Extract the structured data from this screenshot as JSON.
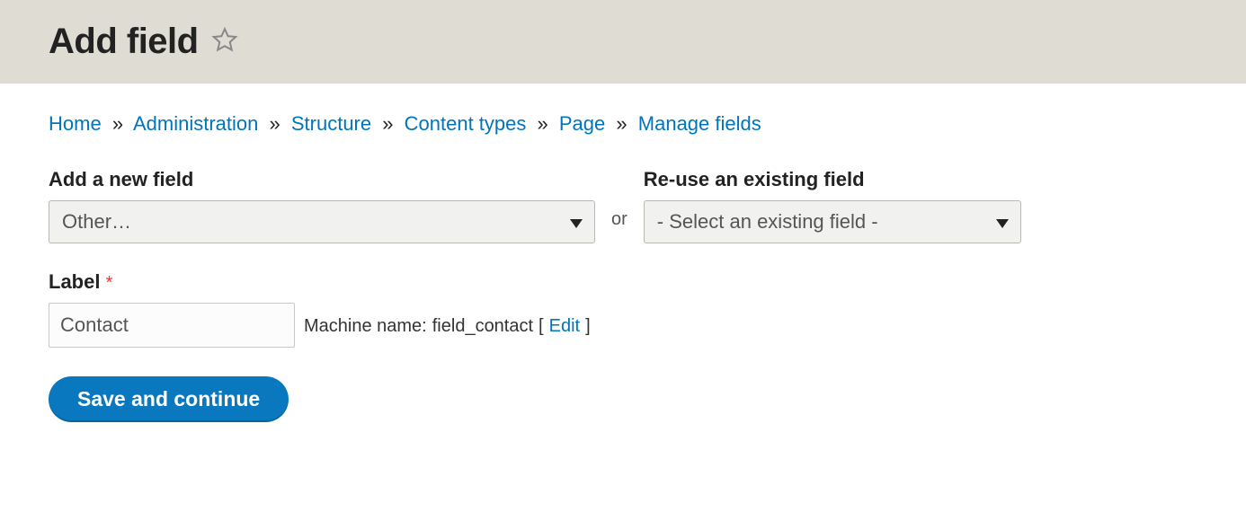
{
  "header": {
    "title": "Add field"
  },
  "breadcrumb": {
    "items": [
      {
        "label": "Home"
      },
      {
        "label": "Administration"
      },
      {
        "label": "Structure"
      },
      {
        "label": "Content types"
      },
      {
        "label": "Page"
      },
      {
        "label": "Manage fields"
      }
    ],
    "separator": "»"
  },
  "form": {
    "new_field": {
      "label": "Add a new field",
      "selected": "Other…"
    },
    "or_text": "or",
    "existing_field": {
      "label": "Re-use an existing field",
      "selected": "- Select an existing field -"
    },
    "label_field": {
      "label": "Label",
      "required_marker": "*",
      "value": "Contact"
    },
    "machine_name": {
      "prefix": "Machine name:",
      "value": "field_contact",
      "edit_label": "Edit"
    },
    "submit_label": "Save and continue"
  }
}
